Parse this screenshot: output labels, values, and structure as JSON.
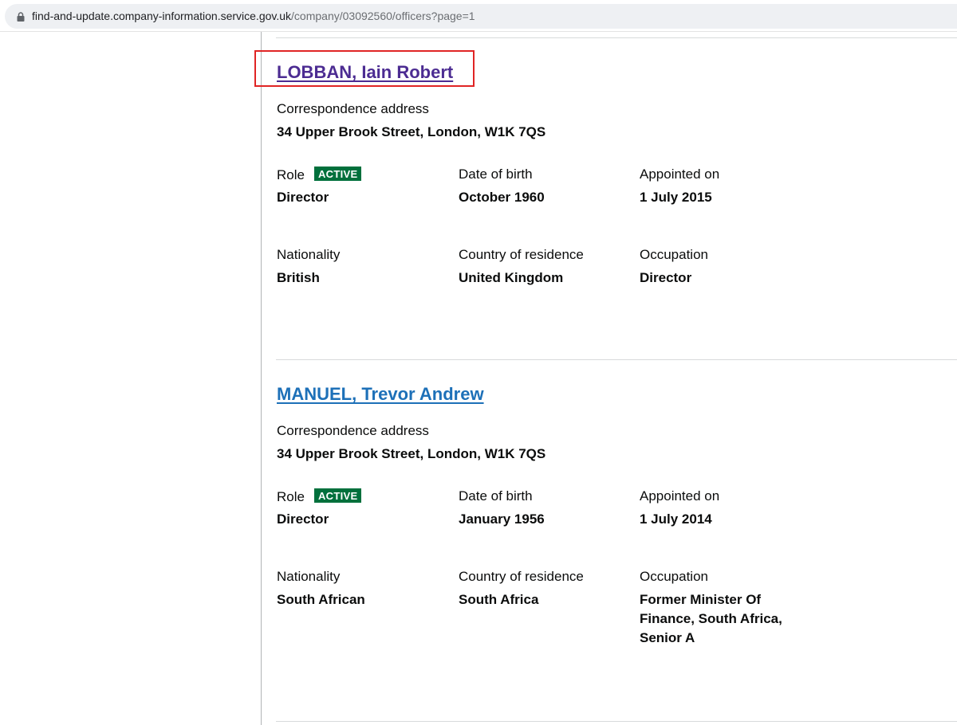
{
  "browser": {
    "url_host": "find-and-update.company-information.service.gov.uk",
    "url_path": "/company/03092560/officers?page=1"
  },
  "officers": [
    {
      "name": "LOBBAN, Iain Robert",
      "address_label": "Correspondence address",
      "address": "34 Upper Brook Street, London, W1K 7QS",
      "role_label": "Role",
      "status": "ACTIVE",
      "role": "Director",
      "dob_label": "Date of birth",
      "dob": "October 1960",
      "appointed_label": "Appointed on",
      "appointed": "1 July 2015",
      "nationality_label": "Nationality",
      "nationality": "British",
      "residence_label": "Country of residence",
      "residence": "United Kingdom",
      "occupation_label": "Occupation",
      "occupation": "Director"
    },
    {
      "name": "MANUEL, Trevor Andrew",
      "address_label": "Correspondence address",
      "address": "34 Upper Brook Street, London, W1K 7QS",
      "role_label": "Role",
      "status": "ACTIVE",
      "role": "Director",
      "dob_label": "Date of birth",
      "dob": "January 1956",
      "appointed_label": "Appointed on",
      "appointed": "1 July 2014",
      "nationality_label": "Nationality",
      "nationality": "South African",
      "residence_label": "Country of residence",
      "residence": "South Africa",
      "occupation_label": "Occupation",
      "occupation": "Former Minister Of Finance, South Africa, Senior A"
    }
  ],
  "colors": {
    "visited_link": "#4c2c92",
    "link": "#1d70b8",
    "active_badge": "#00703c",
    "highlight": "#e02424"
  }
}
